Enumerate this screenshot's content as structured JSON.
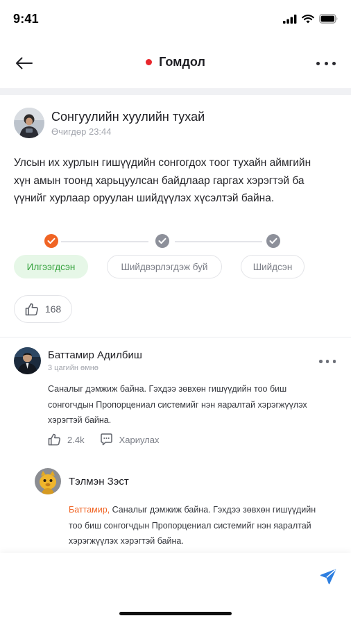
{
  "status_bar": {
    "time": "9:41"
  },
  "header": {
    "title": "Гомдол",
    "back_icon": "arrow-left-icon",
    "more_icon": "more-horizontal-icon",
    "status_color": "#e8262c"
  },
  "post": {
    "title": "Сонгуулийн хуулийн тухай",
    "time": "Өчигдөр 23:44",
    "body": "Улсын их хурлын гишүүдийн сонгогдох тоог тухайн аймгийн хүн амын тоонд харьцуулсан байдлаар гаргах хэрэгтэй ба үүнийг хурлаар оруулан шийдүүлэх хүсэлтэй байна.",
    "steps": [
      {
        "label": "Илгээгдсэн",
        "state": "current"
      },
      {
        "label": "Шийдвэрлэгдэж буй",
        "state": "pending"
      },
      {
        "label": "Шийдсэн",
        "state": "pending"
      }
    ],
    "likes": "168"
  },
  "comments": [
    {
      "name": "Баттамир Адилбиш",
      "time": "3 цагийн өмнө",
      "text": "Саналыг дэмжиж байна. Гэхдээ зөвхөн гишүүдийн тоо биш сонгогчдын Пропорцениал системийг нэн яаралтай хэрэгжүүлэх хэрэгтэй байна.",
      "likes": "2.4k",
      "reply_label": "Хариулах"
    },
    {
      "name": "Тэлмэн Зэст",
      "mention": "Баттамир,",
      "text": " Саналыг дэмжиж байна. Гэхдээ зөвхөн гишүүдийн тоо биш сонгогчдын Пропорцениал системийг нэн яаралтай хэрэгжүүлэх хэрэгтэй байна."
    }
  ],
  "composer": {
    "placeholder": "",
    "send_icon": "send-icon"
  },
  "colors": {
    "accent_orange": "#f06424",
    "active_green": "#35a23d",
    "active_green_bg": "#e6f7e7",
    "pending_gray": "#8d909a"
  }
}
